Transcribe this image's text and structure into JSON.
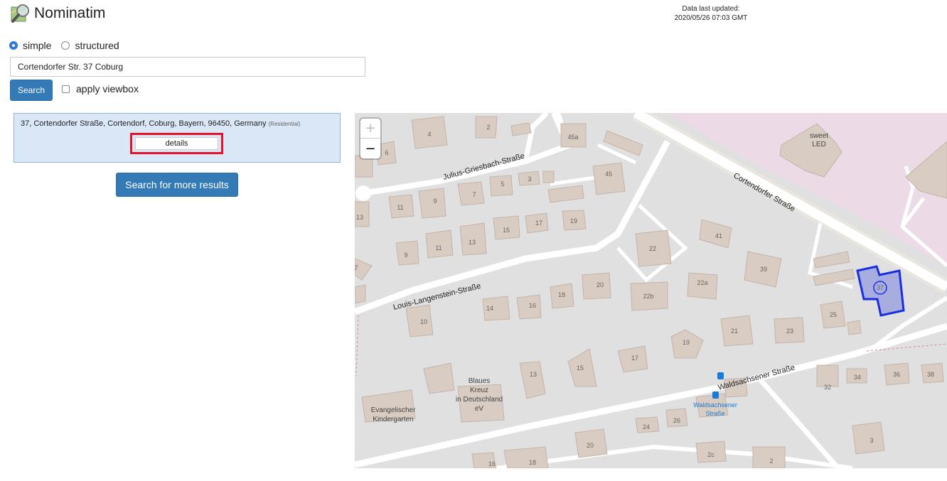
{
  "app": {
    "title": "Nominatim",
    "logo_icon": "magnifier-map-icon"
  },
  "status": {
    "label": "Data last updated:",
    "value": "2020/05/26 07:03 GMT"
  },
  "search_mode": {
    "options": [
      "simple",
      "structured"
    ],
    "selected": "simple"
  },
  "search": {
    "query": "Cortendorfer Str. 37 Coburg",
    "button_label": "Search",
    "viewbox_label": "apply viewbox",
    "viewbox_checked": false
  },
  "results": [
    {
      "address": "37, Cortendorfer Straße, Cortendorf, Coburg, Bayern, 96450, Germany",
      "type": "(Residential)",
      "details_label": "details"
    }
  ],
  "more_results_label": "Search for more results",
  "map": {
    "zoom_in": "+",
    "zoom_out": "−",
    "highlight_color": "#1a2ee0",
    "street_labels": {
      "julius": "Julius-Griesbach-Straße",
      "cortendorfer": "Cortendorfer Straße",
      "louis": "Louis-Langenstein-Straße",
      "waldsachsener": "Waldsachsener Straße"
    },
    "poi_labels": {
      "sweet_line1": "sweet",
      "sweet_line2": "LED",
      "blaues_line1": "Blaues",
      "blaues_line2": "Kreuz",
      "blaues_line3": "in Deutschland",
      "blaues_line4": "eV",
      "kiga_line1": "Evangelischer",
      "kiga_line2": "Kindergarten",
      "bus_line1": "Waldsachsener",
      "bus_line2": "Straße"
    },
    "house_numbers": {
      "n4": "4",
      "n2a": "2",
      "n6": "6",
      "n45a": "45a",
      "n45": "45",
      "n3a": "3",
      "n5": "5",
      "n7a": "7",
      "n9a": "9",
      "n11a": "11",
      "n13a": "13",
      "n15a": "15",
      "n17a": "17",
      "n19a": "19",
      "n9b": "9",
      "n11b": "11",
      "n13b": "13",
      "n22": "22",
      "n41": "41",
      "n39": "39",
      "n37": "37",
      "n7b": "7",
      "n20a": "20",
      "n18a": "18",
      "n16a": "16",
      "n14": "14",
      "n10": "10",
      "n22b": "22b",
      "n22a": "22a",
      "n25": "25",
      "n21": "21",
      "n23": "23",
      "n19b": "19",
      "n17b": "17",
      "n15b": "15",
      "n13c": "13",
      "n34": "34",
      "n36": "36",
      "n38": "38",
      "n32": "32",
      "n24": "24",
      "n26": "26",
      "n20b": "20",
      "n2c": "2c",
      "n2b": "2",
      "n16b": "16",
      "n18b": "18",
      "n3b": "3"
    }
  }
}
